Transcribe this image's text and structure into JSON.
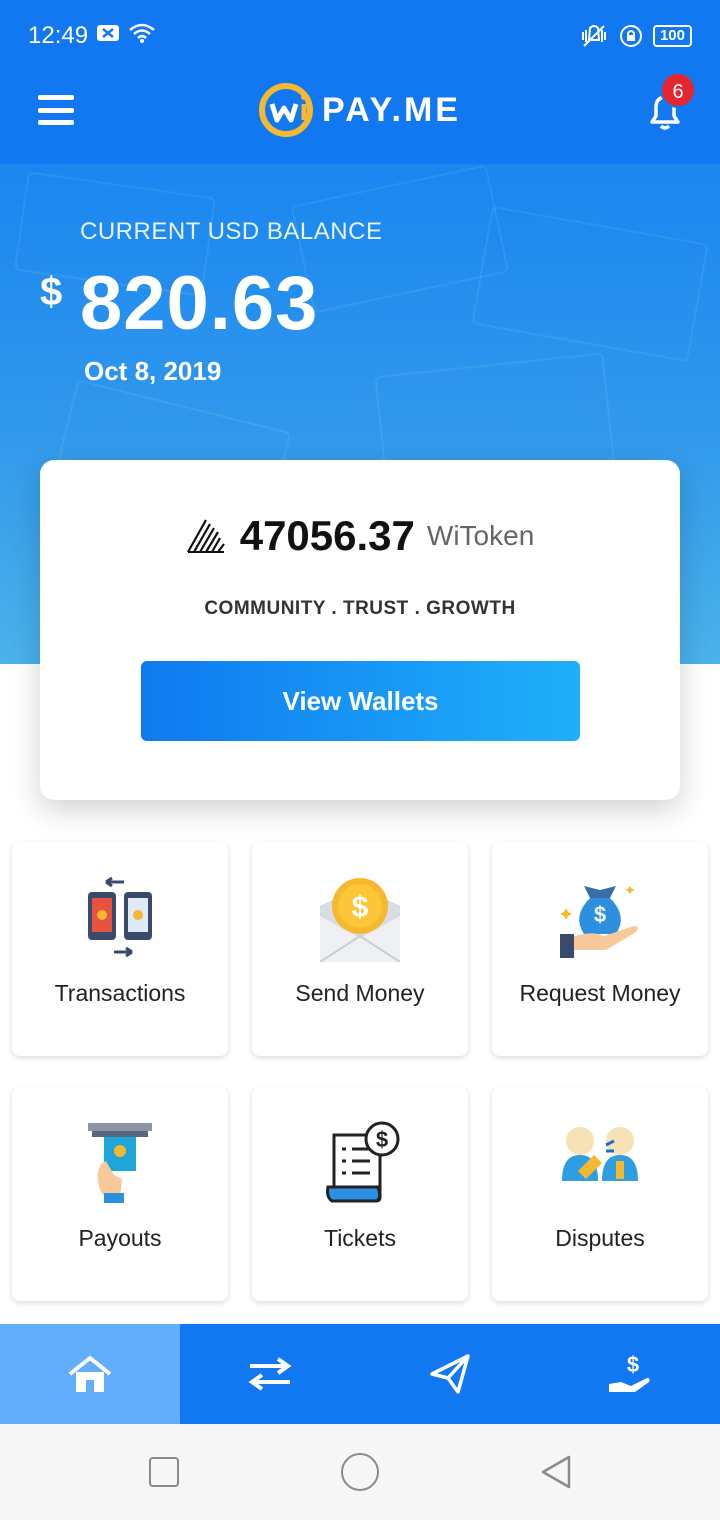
{
  "status_bar": {
    "time": "12:49",
    "battery": "100"
  },
  "header": {
    "logo_text": "PAY.ME",
    "notification_count": "6"
  },
  "balance": {
    "label": "CURRENT USD BALANCE",
    "currency_symbol": "$",
    "amount": "820.63",
    "date": "Oct 8, 2019"
  },
  "token_card": {
    "value": "47056.37",
    "unit": "WiToken",
    "tagline": "COMMUNITY . TRUST . GROWTH",
    "button_label": "View Wallets"
  },
  "tiles": [
    {
      "label": "Transactions",
      "icon": "transactions-icon"
    },
    {
      "label": "Send Money",
      "icon": "send-money-icon"
    },
    {
      "label": "Request Money",
      "icon": "request-money-icon"
    },
    {
      "label": "Payouts",
      "icon": "payouts-icon"
    },
    {
      "label": "Tickets",
      "icon": "tickets-icon"
    },
    {
      "label": "Disputes",
      "icon": "disputes-icon"
    }
  ],
  "bottom_nav": [
    {
      "icon": "home-icon",
      "active": true
    },
    {
      "icon": "transfer-icon",
      "active": false
    },
    {
      "icon": "send-icon",
      "active": false
    },
    {
      "icon": "receive-money-icon",
      "active": false
    }
  ],
  "colors": {
    "primary": "#1278f2",
    "active_nav": "#63aefc",
    "badge": "#e5262f",
    "logo_yellow": "#f5b82e"
  }
}
